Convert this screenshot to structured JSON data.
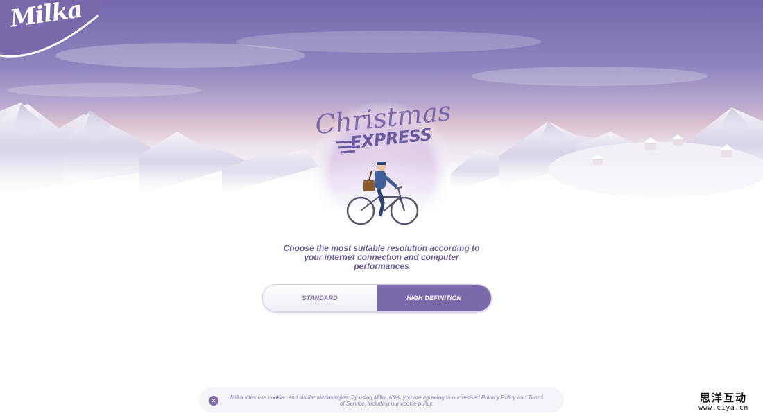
{
  "brand": {
    "logo_text": "Milka"
  },
  "hero": {
    "title": "Christmas",
    "subtitle": "EXPRESS"
  },
  "resolution": {
    "prompt": "Choose the most suitable resolution according to your internet connection and computer performances",
    "options": [
      {
        "label": "STANDARD",
        "selected": false
      },
      {
        "label": "HIGH DEFINITION",
        "selected": true
      }
    ]
  },
  "cookie": {
    "close_icon": "close-icon",
    "text": "Milka sites use cookies and similar technologies. By using Milka sites, you are agreeing to our revised Privacy Policy and Terms of Service, including our cookie policy."
  },
  "watermark": {
    "name": "思洋互动",
    "url": "www.ciya.cn"
  },
  "colors": {
    "brand_purple": "#7a6aab",
    "text_purple": "#6d5f95",
    "sky_top": "#7f72b3"
  }
}
